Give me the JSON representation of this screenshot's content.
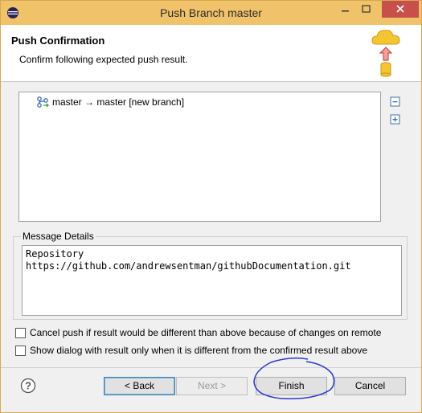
{
  "window": {
    "title": "Push Branch master"
  },
  "header": {
    "title": "Push Confirmation",
    "description": "Confirm following expected push result."
  },
  "tree": {
    "items": [
      {
        "label": "master → master [new branch]"
      }
    ]
  },
  "message_details": {
    "group_label": "Message Details",
    "lines": [
      "Repository",
      "https://github.com/andrewsentman/githubDocumentation.git"
    ]
  },
  "options": {
    "cancel_push_label": "Cancel push if result would be different than above because of changes on remote",
    "show_dialog_label": "Show dialog with result only when it is different from the confirmed result above"
  },
  "buttons": {
    "back_label": "< Back",
    "next_label": "Next >",
    "finish_label": "Finish",
    "cancel_label": "Cancel"
  },
  "colors": {
    "titlebar": "#f0c26a",
    "close_button": "#c7504b",
    "annotation": "#2a35c9"
  }
}
